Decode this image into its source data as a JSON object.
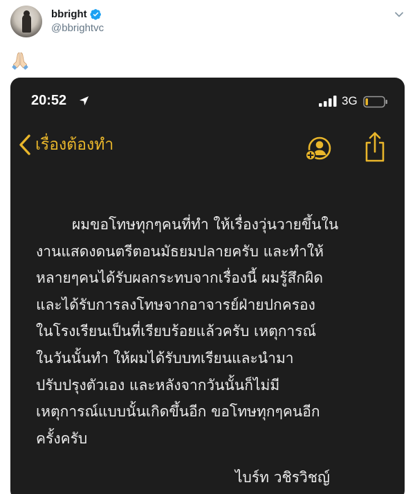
{
  "tweet": {
    "display_name": "bbright",
    "handle": "@bbrightvc",
    "verified": true,
    "emoji": "🙏🏻",
    "icons": {
      "verified": "verified-badge-icon",
      "more": "chevron-down-icon",
      "emoji": "praying-hands-icon"
    }
  },
  "phone": {
    "status_bar": {
      "time": "20:52",
      "network": "3G",
      "icons": [
        "location-arrow-icon",
        "signal-icon",
        "battery-icon"
      ]
    },
    "nav": {
      "back_label": "เรื่องต้องทำ",
      "icons": [
        "back-chevron-icon",
        "add-person-icon",
        "share-icon"
      ]
    },
    "note": {
      "lines": [
        "ผมขอโทษทุกๆคนที่ทำ ให้เรื่องวุ่นวายขึ้นใน",
        "งานแสดงดนตรีตอนมัธยมปลายครับ และทำให้",
        "หลายๆคนได้รับผลกระทบจากเรื่องนี้ ผมรู้สึกผิด",
        "และได้รับการลงโทษจากอาจารย์ฝ่ายปกครอง",
        "ในโรงเรียนเป็นที่เรียบร้อยแล้วครับ เหตุการณ์",
        "ในวันนั้นทำ ให้ผมได้รับบทเรียนและนำมา",
        "ปรับปรุงตัวเอง และหลังจากวันนั้นก็ไม่มี",
        "เหตุการณ์แบบนั้นเกิดขึ้นอีก ขอโทษทุกๆคนอีก",
        "ครั้งครับ"
      ],
      "signature": "ไบร์ท วชิรวิชญ์"
    }
  },
  "colors": {
    "accent": "#e9b62b",
    "note_background": "#1d1d1d",
    "note_text": "#ececec",
    "verified_blue": "#1da1f2",
    "handle_gray": "#657786"
  }
}
